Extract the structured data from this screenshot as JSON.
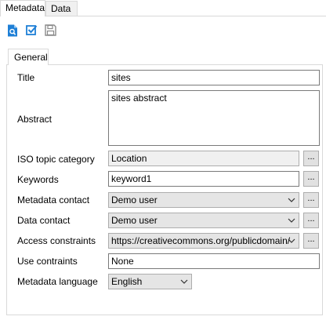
{
  "tabs": [
    "Metadata",
    "Data"
  ],
  "toolbar": {
    "icons": [
      "search-document-icon",
      "checkbox-icon",
      "save-icon"
    ]
  },
  "section_tab": "General",
  "fields": {
    "title": {
      "label": "Title",
      "value": "sites"
    },
    "abstract": {
      "label": "Abstract",
      "value": "sites abstract"
    },
    "iso_topic": {
      "label": "ISO topic category",
      "value": "Location",
      "button": "..."
    },
    "keywords": {
      "label": "Keywords",
      "value": "keyword1",
      "button": "..."
    },
    "metadata_contact": {
      "label": "Metadata contact",
      "value": "Demo user",
      "button": "..."
    },
    "data_contact": {
      "label": "Data contact",
      "value": "Demo user",
      "button": "..."
    },
    "access_constraints": {
      "label": "Access constraints",
      "value": "https://creativecommons.org/publicdomain/",
      "button": "..."
    },
    "use_constraints": {
      "label": "Use contraints",
      "value": "None"
    },
    "metadata_language": {
      "label": "Metadata language",
      "value": "English"
    }
  },
  "colors": {
    "accent": "#1e7fd6",
    "save_icon": "#8a8a8a"
  }
}
